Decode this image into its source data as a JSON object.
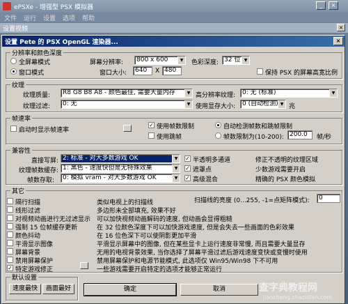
{
  "main_window": {
    "title": "ePSXe - 增强型 PSX 模拟器",
    "menu": [
      "文件",
      "运行",
      "设置",
      "选项",
      "帮助"
    ]
  },
  "video_window": {
    "title": "设置视频"
  },
  "dialog": {
    "title": "设置 Pete 的 PSX OpenGL 渲染器...",
    "resolution": {
      "label": "分辨率和颜色深度",
      "fullscreen": "全屏幕模式",
      "windowed": "窗口模式",
      "res_label": "屏幕分辨率:",
      "res_value": "800 x 600",
      "color_label": "色彩深度:",
      "color_value": "32 位",
      "win_size_label": "窗口大小:",
      "win_w": "640",
      "win_x": "X",
      "win_h": "480",
      "keep_ratio": "保持 PSX 的屏幕高宽比例"
    },
    "texture": {
      "label": "纹理",
      "quality_label": "纹理质量:",
      "quality_value": "R8 G8 B8 A8 - 颜色最佳, 需要大量内存",
      "hires_label": "高分辨率纹理:",
      "hires_value": "0: 无 (标准)",
      "filter_label": "纹理过滤:",
      "filter_value": "0: 无",
      "vram_label": "使用显存大小:",
      "vram_value": "0 (自动检测)",
      "vram_unit": "兆"
    },
    "framerate": {
      "label": "帧速率",
      "show_fps": "启动时显示帧速率",
      "use_limit": "使用帧数限制",
      "use_skip": "使用跳帧",
      "auto_limit": "自动检测帧数和跳帧限制",
      "limit_range": "帧数限制为(10-200):",
      "limit_value": "200.0",
      "unit": "帧/秒"
    },
    "compat": {
      "label": "兼容性",
      "direct_write_label": "直接写屏:",
      "direct_write_value": "2: 标准 - 对大多数游戏 OK",
      "fb_tex_label": "纹理帧数缓存:",
      "fb_tex_value": "1: 黑色 - 速度快但是无特殊效果",
      "fb_access_label": "帧数存取:",
      "fb_access_value": "0: 模拟 vram - 对大多数游戏 OK",
      "semi": "半透明多通道",
      "semi_desc": "修正不透明的纹理区域",
      "mask": "遮罩点",
      "mask_desc": "少数游戏需要开启",
      "blend": "高级混合",
      "blend_desc": "精确的 PSX 颜色模拟"
    },
    "misc": {
      "label": "其它",
      "items": [
        {
          "label": "隔行扫描",
          "desc": "类似电视上的扫描线",
          "checked": false
        },
        {
          "label": "线形过滤",
          "desc": "多边形未全部填充, 效果不好",
          "checked": false
        },
        {
          "label": "对视频动画进行无过滤显示",
          "desc": "可以加快视频动画解码的速度, 但动画会显得粗糙",
          "checked": false
        },
        {
          "label": "强制 15 位帧缓存更新",
          "desc": "在 32 位颜色深度下可以加快游戏速度, 但是会失去一些画面的色彩效果",
          "checked": false
        },
        {
          "label": "颜色抖动",
          "desc": "在 16 位色深下可以使阴影更加平滑",
          "checked": false
        },
        {
          "label": "平滑显示图像",
          "desc": "平滑显示屏幕中的图像, 但在某些显卡上运行速度非常慢, 而且需要大量显存",
          "checked": false
        },
        {
          "label": "屏幕背景",
          "desc": "无用的电视背景效果, 当你选择了屏幕平滑过滤后游戏速度变快或变慢时使用",
          "checked": false
        },
        {
          "label": "禁用屏幕保护",
          "desc": "禁用屏幕保护和电源节能模式, 此选项仅 Win95/Win98 下不可用",
          "checked": false
        },
        {
          "label": "特定游戏修正",
          "desc": "一些游戏需要开启特定的选项才能够正常运行",
          "checked": true
        }
      ],
      "scanline_label": "扫描线的亮度 (0...255, -1=点矩阵模式):",
      "scanline_value": "0"
    },
    "defaults": {
      "label": "默认设置",
      "speed": "速度最快",
      "quality": "画面最好"
    },
    "ok": "确定",
    "cancel": "取消"
  },
  "watermark": {
    "site": "查字典教程网",
    "url": "jiaocheng.chazidian.com"
  }
}
